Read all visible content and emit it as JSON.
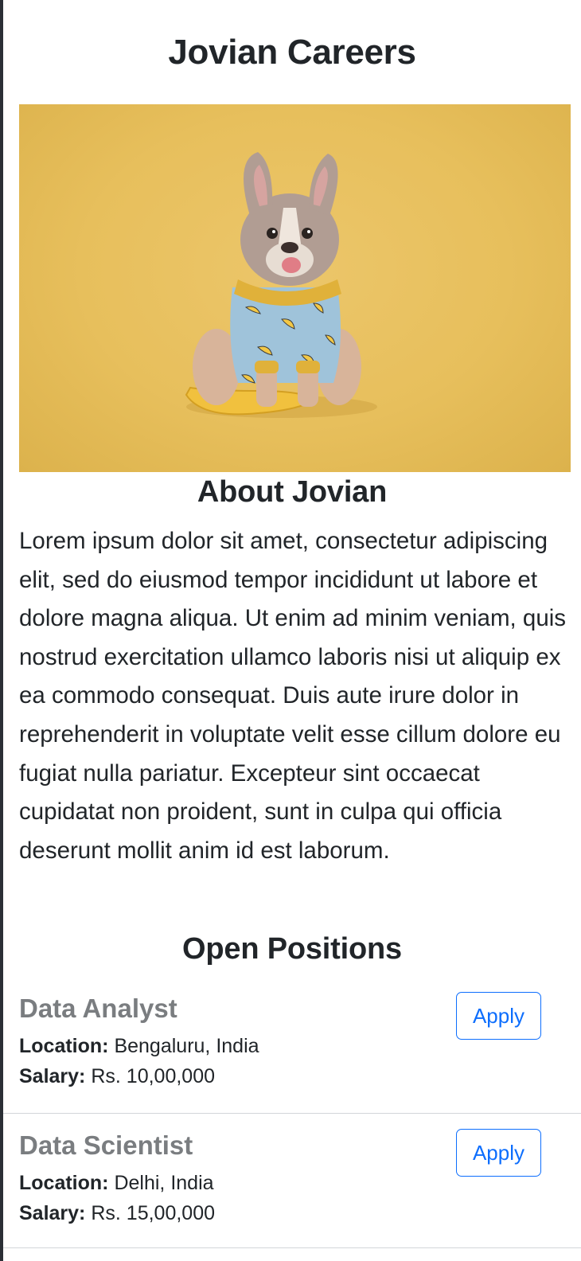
{
  "page": {
    "title": "Jovian Careers"
  },
  "hero_image": {
    "alt": "French bulldog in banana pajamas on yellow background"
  },
  "about": {
    "heading": "About Jovian",
    "text": "Lorem ipsum dolor sit amet, consectetur adipiscing elit, sed do eiusmod tempor incididunt ut labore et dolore magna aliqua. Ut enim ad minim veniam, quis nostrud exercitation ullamco laboris nisi ut aliquip ex ea commodo consequat. Duis aute irure dolor in reprehenderit in voluptate velit esse cillum dolore eu fugiat nulla pariatur. Excepteur sint occaecat cupidatat non proident, sunt in culpa qui officia deserunt mollit anim id est laborum."
  },
  "positions": {
    "heading": "Open Positions",
    "location_label": "Location:",
    "salary_label": "Salary:",
    "apply_label": "Apply",
    "jobs": [
      {
        "title": "Data Analyst",
        "location": "Bengaluru, India",
        "salary": "Rs. 10,00,000"
      },
      {
        "title": "Data Scientist",
        "location": "Delhi, India",
        "salary": "Rs. 15,00,000"
      }
    ]
  },
  "colors": {
    "accent": "#0d6efd",
    "hero_background": "#e7bf5c",
    "job_title": "#7a7d80"
  }
}
